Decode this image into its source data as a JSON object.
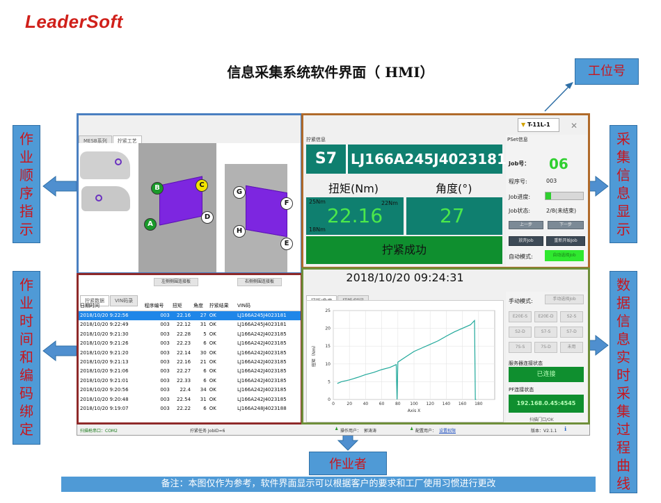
{
  "logo": "LeaderSoft",
  "page_title": "信息采集系统软件界面（ HMI）",
  "callouts": {
    "station": "工位号",
    "work_sequence": "作业顺序指示",
    "collect_display": "采集信息显示",
    "time_code_binding": "作业时间和编码绑定",
    "realtime_curve": "数据信息实时采集过程曲线",
    "operator": "作业者",
    "note": "备注：本图仅作为参考，软件界面显示可以根据客户的要求和工厂使用习惯进行更改"
  },
  "app": {
    "station_id": "T-11L-1",
    "left_tabs": [
      "MESB系列",
      "拧紧工艺"
    ],
    "sequence_badges": [
      "A",
      "B",
      "C",
      "D",
      "E",
      "F",
      "G",
      "H"
    ],
    "tighten_info_title": "拧紧信息",
    "station_code": "S7",
    "vin": "LJ166A245J4023181",
    "torque_label": "扭矩(Nm)",
    "angle_label": "角度(°)",
    "torque_upper": "25Nm",
    "torque_limit": "22Nm",
    "torque_lower": "18Nm",
    "torque_value": "22.16",
    "angle_value": "27",
    "result_text": "拧紧成功",
    "pset": {
      "title": "PSet信息",
      "job_label": "Job号：",
      "job_value": "06",
      "program_label": "程序号:",
      "program_value": "003",
      "progress_label": "Job进度:",
      "progress_fraction": 0.15,
      "state_label": "Job状态:",
      "state_value": "2/8(未结束)",
      "btn_prev": "上一步",
      "btn_next": "下一步",
      "btn_abandon": "放弃Job",
      "btn_restart": "重新开始Job",
      "auto_label": "自动模式:",
      "auto_btn": "自动选择Job"
    },
    "datetime": "2018/10/20 09:24:31",
    "chart_tabs": [
      "扭矩/角度",
      "扭矩/时间"
    ],
    "manual": {
      "label": "手动模式:",
      "btn": "手动选择Job",
      "grid": [
        "E20E-S",
        "E20E-D",
        "S2-S",
        "S2-D",
        "S7-S",
        "S7-D",
        "7S-S",
        "7S-D",
        "未用"
      ],
      "server_label": "服务器连接状态",
      "server_value": "已连接",
      "pf_label": "PF连接状态",
      "pf_value": "192.168.0.45:4545",
      "pf_cut": "扫描门口/OK"
    },
    "table": {
      "btn_left": "左侧侧围连接板",
      "btn_right": "右侧侧围连接板",
      "tabs": [
        "拧紧数据",
        "VIN码录"
      ],
      "headers": [
        "日期时间",
        "程序编号",
        "扭矩",
        "角度",
        "拧紧结果",
        "VIN码"
      ],
      "rows": [
        [
          "2018/10/20 9:22:56",
          "003",
          "22.16",
          "27",
          "OK",
          "LJ166A245J4023181"
        ],
        [
          "2018/10/20 9:22:49",
          "003",
          "22.12",
          "31",
          "OK",
          "LJ166A245J4023181"
        ],
        [
          "2018/10/20 9:21:30",
          "003",
          "22.28",
          "5",
          "OK",
          "LJ166A242J4023185"
        ],
        [
          "2018/10/20 9:21:26",
          "003",
          "22.23",
          "6",
          "OK",
          "LJ166A242J4023185"
        ],
        [
          "2018/10/20 9:21:20",
          "003",
          "22.14",
          "30",
          "OK",
          "LJ166A242J4023185"
        ],
        [
          "2018/10/20 9:21:13",
          "003",
          "22.16",
          "21",
          "OK",
          "LJ166A242J4023185"
        ],
        [
          "2018/10/20 9:21:06",
          "003",
          "22.27",
          "6",
          "OK",
          "LJ166A242J4023185"
        ],
        [
          "2018/10/20 9:21:01",
          "003",
          "22.33",
          "6",
          "OK",
          "LJ166A242J4023185"
        ],
        [
          "2018/10/20 9:20:56",
          "003",
          "22.4",
          "34",
          "OK",
          "LJ166A242J4023185"
        ],
        [
          "2018/10/20 9:20:48",
          "003",
          "22.54",
          "31",
          "OK",
          "LJ166A242J4023185"
        ],
        [
          "2018/10/20 9:19:07",
          "003",
          "22.22",
          "6",
          "OK",
          "LJ166A248J4023188"
        ]
      ]
    },
    "status": {
      "port": "扫描枪串口：COM2",
      "job": "拧紧任务 JobID=6",
      "operator_label": "操作用户：",
      "operator": "郭涛涛",
      "config_label": "配置用户：",
      "config": "设置权限",
      "version": "版本：V2.1.1"
    }
  },
  "chart_data": {
    "type": "line",
    "xlabel": "Axis X",
    "ylabel": "扭矩（Nm）",
    "xlim": [
      0,
      200
    ],
    "ylim": [
      0,
      25
    ],
    "xticks": [
      0,
      20,
      40,
      60,
      80,
      100,
      120,
      140,
      160,
      180
    ],
    "yticks": [
      0,
      5,
      10,
      15,
      20,
      25
    ],
    "series": [
      {
        "color": "#1fa89a",
        "x": [
          5,
          10,
          20,
          30,
          40,
          50,
          60,
          70,
          78,
          79,
          80,
          90,
          100,
          110,
          120,
          130,
          140,
          150,
          160,
          170,
          175,
          176,
          177
        ],
        "y": [
          4.5,
          5.0,
          5.5,
          6.2,
          7.0,
          7.6,
          8.4,
          9.0,
          9.8,
          0,
          10.5,
          12.0,
          13.5,
          14.5,
          15.5,
          16.5,
          17.8,
          19.0,
          20.0,
          21.0,
          22.2,
          0,
          0
        ]
      }
    ]
  }
}
